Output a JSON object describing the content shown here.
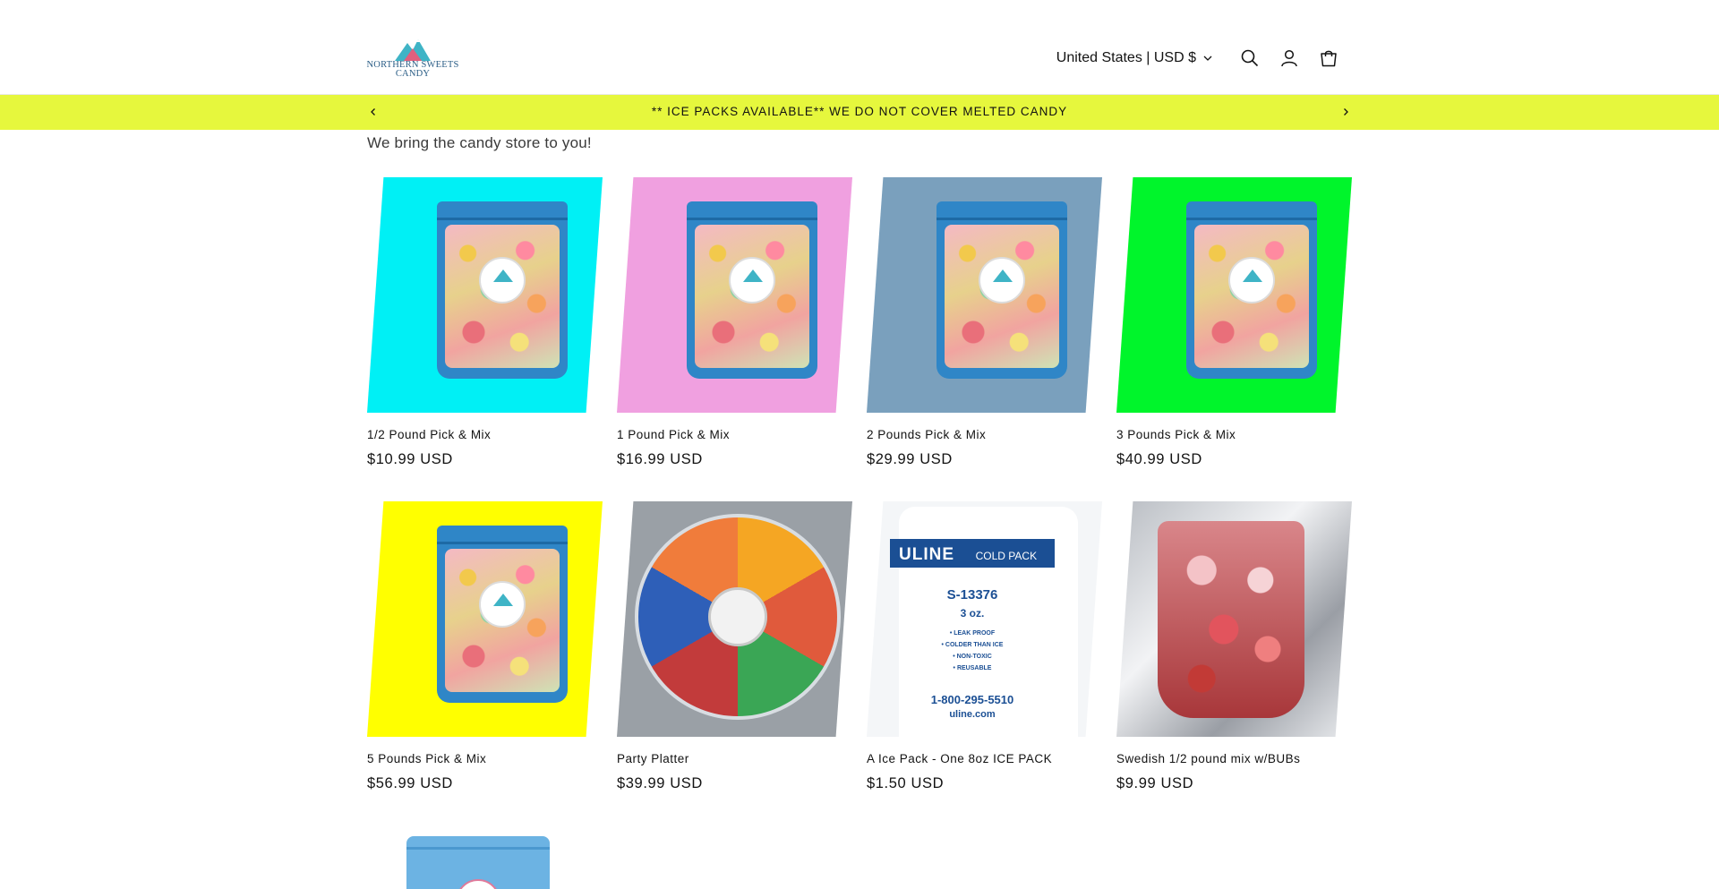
{
  "header": {
    "logo": {
      "line1": "NORTHERN SWEETS",
      "line2": "CANDY"
    },
    "country_selector": "United States | USD $",
    "icons": [
      "search-icon",
      "account-icon",
      "cart-icon"
    ]
  },
  "announcement": {
    "text": "** ICE PACKS AVAILABLE** WE DO NOT COVER MELTED CANDY",
    "bg_color": "#e6f73d"
  },
  "tagline": "We bring the candy store to you!",
  "products": [
    {
      "title": "1/2 Pound Pick & Mix",
      "price": "$10.99 USD",
      "bg_color": "#00f0f5"
    },
    {
      "title": "1 Pound Pick & Mix",
      "price": "$16.99 USD",
      "bg_color": "#f0a0e0"
    },
    {
      "title": "2 Pounds Pick & Mix",
      "price": "$29.99 USD",
      "bg_color": "#7aa0bd"
    },
    {
      "title": "3 Pounds Pick & Mix",
      "price": "$40.99 USD",
      "bg_color": "#00f52b"
    },
    {
      "title": "5 Pounds Pick & Mix",
      "price": "$56.99 USD",
      "bg_color": "#ffff00"
    },
    {
      "title": "Party Platter",
      "price": "$39.99 USD"
    },
    {
      "title": "A Ice Pack - One 8oz ICE PACK",
      "price": "$1.50 USD",
      "image_text": {
        "brand": "ULINE",
        "kind": "COLD PACK",
        "sku": "S-13376",
        "size": "3 oz.",
        "features": [
          "• LEAK PROOF",
          "• COLDER THAN ICE",
          "• NON-TOXIC",
          "• REUSABLE"
        ],
        "phone": "1-800-295-5510",
        "site": "uline.com"
      }
    },
    {
      "title": "Swedish 1/2 pound mix w/BUBs",
      "price": "$9.99 USD"
    }
  ]
}
